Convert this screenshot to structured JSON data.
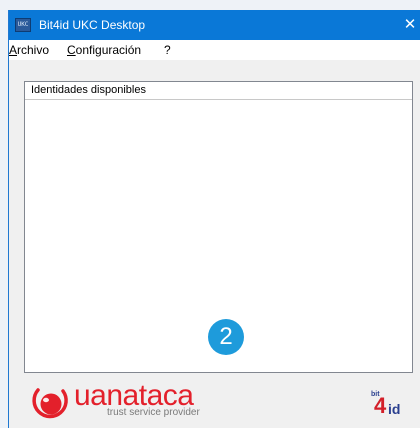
{
  "window": {
    "title": "Bit4id UKC Desktop",
    "app_icon_text": "UKC",
    "close_glyph": "✕"
  },
  "menu": {
    "items": [
      {
        "mnemonic": "A",
        "rest": "rchivo"
      },
      {
        "mnemonic": "C",
        "rest": "onfiguración"
      },
      {
        "mnemonic": "",
        "rest": "?"
      }
    ]
  },
  "identities_panel": {
    "header": "Identidades disponibles"
  },
  "step_badge": {
    "number": "2",
    "color": "#1e9bdb"
  },
  "footer": {
    "uanataca": {
      "name": "uanataca",
      "tagline": "trust service provider",
      "brand_color": "#e3202b"
    },
    "bit4id": {
      "prefix": "bit",
      "digit": "4",
      "suffix": "id"
    }
  },
  "colors": {
    "titlebar": "#0a78d7",
    "client_background": "#f0f0f0"
  }
}
